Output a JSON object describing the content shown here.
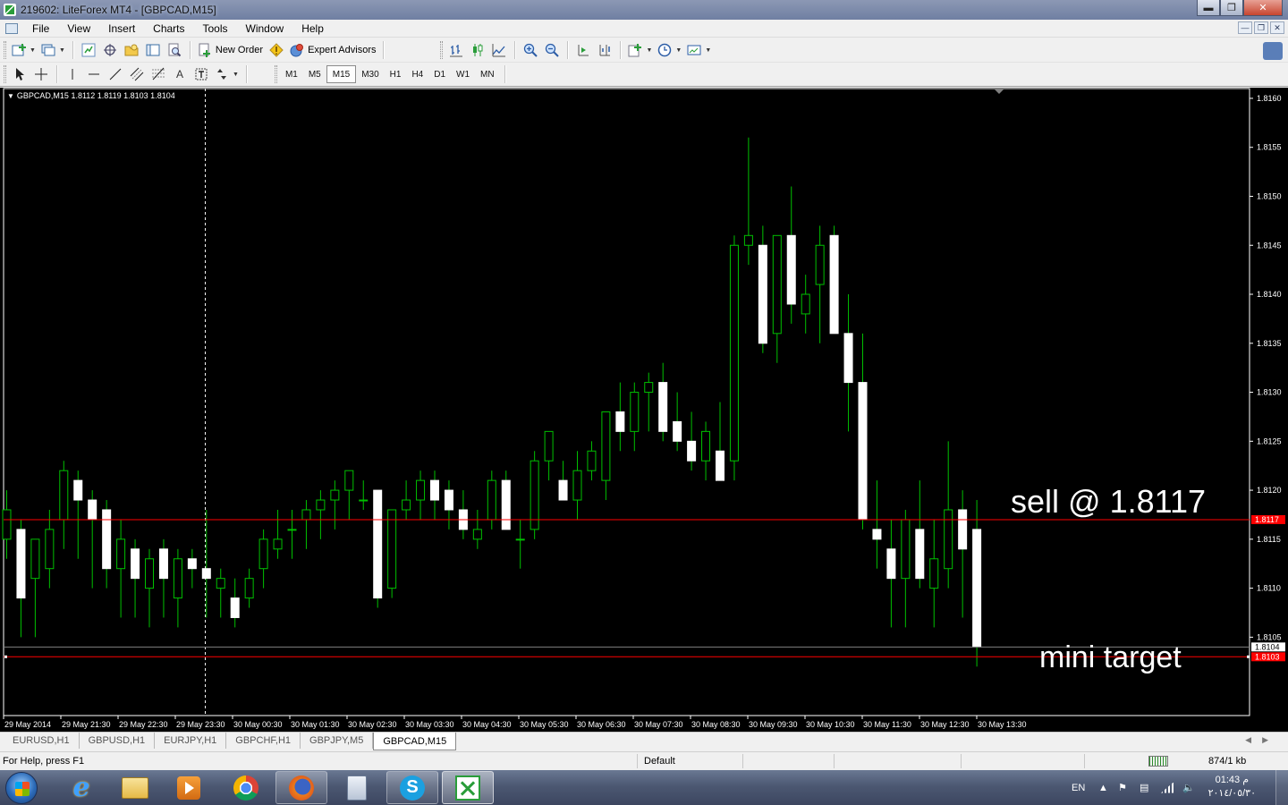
{
  "window": {
    "title": "219602: LiteForex MT4 - [GBPCAD,M15]",
    "controls": [
      "minimize",
      "maximize",
      "close"
    ]
  },
  "menu": {
    "items": [
      "File",
      "View",
      "Insert",
      "Charts",
      "Tools",
      "Window",
      "Help"
    ]
  },
  "toolbar": {
    "new_order_label": "New Order",
    "expert_advisors_label": "Expert Advisors",
    "timeframes": [
      "M1",
      "M5",
      "M15",
      "M30",
      "H1",
      "H4",
      "D1",
      "W1",
      "MN"
    ],
    "active_timeframe": "M15",
    "drawing_text_label": "A"
  },
  "chart": {
    "header": "GBPCAD,M15  1.8112 1.8119 1.8103 1.8104",
    "annotations": {
      "sell": "sell @ 1.8117",
      "target": "mini target"
    },
    "colors": {
      "background": "#000000",
      "bull_body": "#000000",
      "bear_body": "#ffffff",
      "wick": "#00c000",
      "axis": "#ffffff",
      "sell_line": "#ff0000",
      "bid_line": "#808080",
      "target_line": "#ff0000"
    }
  },
  "chart_data": {
    "type": "candlestick",
    "symbol": "GBPCAD",
    "timeframe": "M15",
    "ylim": [
      1.8097,
      1.8161
    ],
    "yticks": [
      "1.8160",
      "1.8155",
      "1.8150",
      "1.8145",
      "1.8140",
      "1.8135",
      "1.8130",
      "1.8125",
      "1.8120",
      "1.8115",
      "1.8110",
      "1.8105"
    ],
    "xticks": [
      "29 May 2014",
      "29 May 21:30",
      "29 May 22:30",
      "29 May 23:30",
      "30 May 00:30",
      "30 May 01:30",
      "30 May 02:30",
      "30 May 03:30",
      "30 May 04:30",
      "30 May 05:30",
      "30 May 06:30",
      "30 May 07:30",
      "30 May 08:30",
      "30 May 09:30",
      "30 May 10:30",
      "30 May 11:30",
      "30 May 12:30",
      "30 May 13:30"
    ],
    "price_labels": {
      "sell": "1.8117",
      "bid": "1.8104",
      "target": "1.8103"
    },
    "levels": {
      "sell": 1.8117,
      "bid": 1.8104,
      "target": 1.8103
    },
    "candles": [
      [
        1.8115,
        1.812,
        1.8113,
        1.8118
      ],
      [
        1.8116,
        1.8117,
        1.8105,
        1.8109
      ],
      [
        1.8111,
        1.8114,
        1.8105,
        1.8115
      ],
      [
        1.8112,
        1.8118,
        1.811,
        1.8116
      ],
      [
        1.8117,
        1.8123,
        1.8114,
        1.8122
      ],
      [
        1.8121,
        1.8122,
        1.8113,
        1.8119
      ],
      [
        1.8119,
        1.812,
        1.811,
        1.8117
      ],
      [
        1.8118,
        1.8119,
        1.811,
        1.8112
      ],
      [
        1.8112,
        1.8117,
        1.8107,
        1.8115
      ],
      [
        1.8114,
        1.8115,
        1.8107,
        1.8111
      ],
      [
        1.811,
        1.8114,
        1.8106,
        1.8113
      ],
      [
        1.8114,
        1.8115,
        1.8107,
        1.8111
      ],
      [
        1.8109,
        1.8114,
        1.8106,
        1.8113
      ],
      [
        1.8113,
        1.8114,
        1.811,
        1.8112
      ],
      [
        1.8112,
        1.8118,
        1.8107,
        1.8111
      ],
      [
        1.811,
        1.8112,
        1.8107,
        1.8111
      ],
      [
        1.8109,
        1.8111,
        1.8106,
        1.8107
      ],
      [
        1.8109,
        1.8112,
        1.8108,
        1.8111
      ],
      [
        1.8112,
        1.8116,
        1.811,
        1.8115
      ],
      [
        1.8114,
        1.8118,
        1.8113,
        1.8115
      ],
      [
        1.8116,
        1.8118,
        1.8113,
        1.8116
      ],
      [
        1.8117,
        1.8119,
        1.8114,
        1.8118
      ],
      [
        1.8118,
        1.812,
        1.8115,
        1.8119
      ],
      [
        1.8119,
        1.8121,
        1.8116,
        1.812
      ],
      [
        1.812,
        1.8122,
        1.8117,
        1.8122
      ],
      [
        1.8119,
        1.8121,
        1.8118,
        1.8119
      ],
      [
        1.812,
        1.812,
        1.8108,
        1.8109
      ],
      [
        1.811,
        1.8118,
        1.8109,
        1.8118
      ],
      [
        1.8118,
        1.8121,
        1.8117,
        1.8119
      ],
      [
        1.8119,
        1.8122,
        1.8117,
        1.8121
      ],
      [
        1.8121,
        1.8122,
        1.8117,
        1.8119
      ],
      [
        1.812,
        1.8121,
        1.8116,
        1.8118
      ],
      [
        1.8118,
        1.812,
        1.8115,
        1.8116
      ],
      [
        1.8115,
        1.8118,
        1.8114,
        1.8116
      ],
      [
        1.8117,
        1.8122,
        1.8116,
        1.8121
      ],
      [
        1.8121,
        1.8122,
        1.8116,
        1.8116
      ],
      [
        1.8115,
        1.8117,
        1.8112,
        1.8115
      ],
      [
        1.8116,
        1.8124,
        1.8115,
        1.8123
      ],
      [
        1.8123,
        1.8126,
        1.8121,
        1.8126
      ],
      [
        1.8121,
        1.8123,
        1.8119,
        1.8119
      ],
      [
        1.8119,
        1.8124,
        1.8117,
        1.8122
      ],
      [
        1.8122,
        1.8125,
        1.8121,
        1.8124
      ],
      [
        1.8121,
        1.8127,
        1.8119,
        1.8128
      ],
      [
        1.8128,
        1.8131,
        1.8124,
        1.8126
      ],
      [
        1.8126,
        1.8131,
        1.8124,
        1.813
      ],
      [
        1.813,
        1.8132,
        1.8126,
        1.8131
      ],
      [
        1.8131,
        1.8133,
        1.8125,
        1.8126
      ],
      [
        1.8127,
        1.813,
        1.8124,
        1.8125
      ],
      [
        1.8125,
        1.8128,
        1.8122,
        1.8123
      ],
      [
        1.8123,
        1.8127,
        1.8121,
        1.8126
      ],
      [
        1.8124,
        1.8129,
        1.8121,
        1.8121
      ],
      [
        1.8123,
        1.8146,
        1.8121,
        1.8145
      ],
      [
        1.8145,
        1.8156,
        1.8143,
        1.8146
      ],
      [
        1.8145,
        1.8147,
        1.8134,
        1.8135
      ],
      [
        1.8136,
        1.8146,
        1.8133,
        1.8146
      ],
      [
        1.8146,
        1.8151,
        1.8137,
        1.8139
      ],
      [
        1.8138,
        1.8142,
        1.8136,
        1.814
      ],
      [
        1.8141,
        1.8147,
        1.8135,
        1.8145
      ],
      [
        1.8146,
        1.8147,
        1.8136,
        1.8136
      ],
      [
        1.8136,
        1.814,
        1.8126,
        1.8131
      ],
      [
        1.8131,
        1.8136,
        1.8116,
        1.8117
      ],
      [
        1.8116,
        1.8121,
        1.8112,
        1.8115
      ],
      [
        1.8114,
        1.8117,
        1.8106,
        1.8111
      ],
      [
        1.8111,
        1.8118,
        1.8106,
        1.8117
      ],
      [
        1.8116,
        1.8121,
        1.811,
        1.8111
      ],
      [
        1.811,
        1.8117,
        1.8106,
        1.8113
      ],
      [
        1.8112,
        1.8125,
        1.811,
        1.8118
      ],
      [
        1.8118,
        1.812,
        1.8107,
        1.8114
      ],
      [
        1.8116,
        1.8119,
        1.8102,
        1.8104
      ]
    ]
  },
  "symbol_tabs": {
    "items": [
      "EURUSD,H1",
      "GBPUSD,H1",
      "EURJPY,H1",
      "GBPCHF,H1",
      "GBPJPY,M5",
      "GBPCAD,M15"
    ],
    "active": "GBPCAD,M15"
  },
  "status": {
    "help": "For Help, press F1",
    "profile": "Default",
    "traffic": "874/1 kb"
  },
  "taskbar": {
    "apps": [
      "start",
      "internet-explorer",
      "file-explorer",
      "media-player",
      "chrome",
      "firefox",
      "calculator",
      "skype",
      "metatrader"
    ],
    "language": "EN",
    "time": "01:43 م",
    "date": "٢٠١٤/٠٥/٣٠"
  }
}
